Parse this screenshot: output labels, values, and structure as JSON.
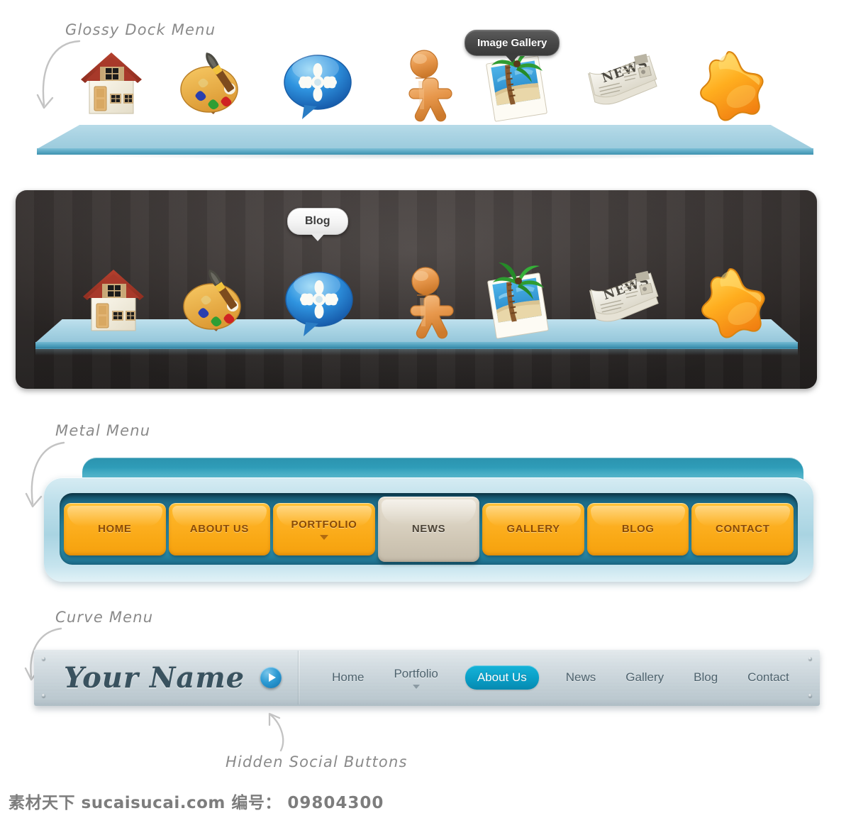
{
  "annotations": {
    "glossy_dock": "Glossy Dock Menu",
    "metal_menu": "Metal Menu",
    "curve_menu": "Curve Menu",
    "hidden_social": "Hidden Social Buttons"
  },
  "dock_light": {
    "tooltip": "Image Gallery",
    "items": [
      {
        "icon": "house-icon",
        "name": "Home"
      },
      {
        "icon": "palette-icon",
        "name": "Portfolio"
      },
      {
        "icon": "speech-bubble-icon",
        "name": "Blog"
      },
      {
        "icon": "person-icon",
        "name": "About Us"
      },
      {
        "icon": "photo-icon",
        "name": "Image Gallery"
      },
      {
        "icon": "newspaper-icon",
        "name": "News"
      },
      {
        "icon": "star-icon",
        "name": "Favorites"
      }
    ]
  },
  "dock_dark": {
    "tooltip": "Blog",
    "items": [
      {
        "icon": "house-icon",
        "name": "Home"
      },
      {
        "icon": "palette-icon",
        "name": "Portfolio"
      },
      {
        "icon": "speech-bubble-icon",
        "name": "Blog"
      },
      {
        "icon": "person-icon",
        "name": "About Us"
      },
      {
        "icon": "photo-icon",
        "name": "Image Gallery"
      },
      {
        "icon": "newspaper-icon",
        "name": "News"
      },
      {
        "icon": "star-icon",
        "name": "Favorites"
      }
    ]
  },
  "metal_menu": {
    "items": [
      {
        "label": "HOME",
        "active": false,
        "dropdown": false
      },
      {
        "label": "ABOUT US",
        "active": false,
        "dropdown": false
      },
      {
        "label": "PORTFOLIO",
        "active": false,
        "dropdown": true
      },
      {
        "label": "NEWS",
        "active": true,
        "dropdown": false
      },
      {
        "label": "GALLERY",
        "active": false,
        "dropdown": false
      },
      {
        "label": "BLOG",
        "active": false,
        "dropdown": false
      },
      {
        "label": "CONTACT",
        "active": false,
        "dropdown": false
      }
    ]
  },
  "curve_menu": {
    "logo": "Your Name",
    "social_toggle_icon": "play-arrow-icon",
    "items": [
      {
        "label": "Home",
        "active": false,
        "dropdown": false
      },
      {
        "label": "Portfolio",
        "active": false,
        "dropdown": true
      },
      {
        "label": "About Us",
        "active": true,
        "dropdown": false
      },
      {
        "label": "News",
        "active": false,
        "dropdown": false
      },
      {
        "label": "Gallery",
        "active": false,
        "dropdown": false
      },
      {
        "label": "Blog",
        "active": false,
        "dropdown": false
      },
      {
        "label": "Contact",
        "active": false,
        "dropdown": false
      }
    ]
  },
  "watermark": {
    "site_cn": "素材天下",
    "site": "sucaisucai.com",
    "id_label": "编号：",
    "id_value": "09804300"
  },
  "colors": {
    "shelf_blue": "#a9d3e3",
    "dark_panel": "#3d3735",
    "metal_orange": "#fcae1f",
    "metal_active": "#d4cbba",
    "curve_bar": "#c6d2d8",
    "curve_active": "#0a9ec6",
    "annotation_gray": "#8a8a8a"
  }
}
